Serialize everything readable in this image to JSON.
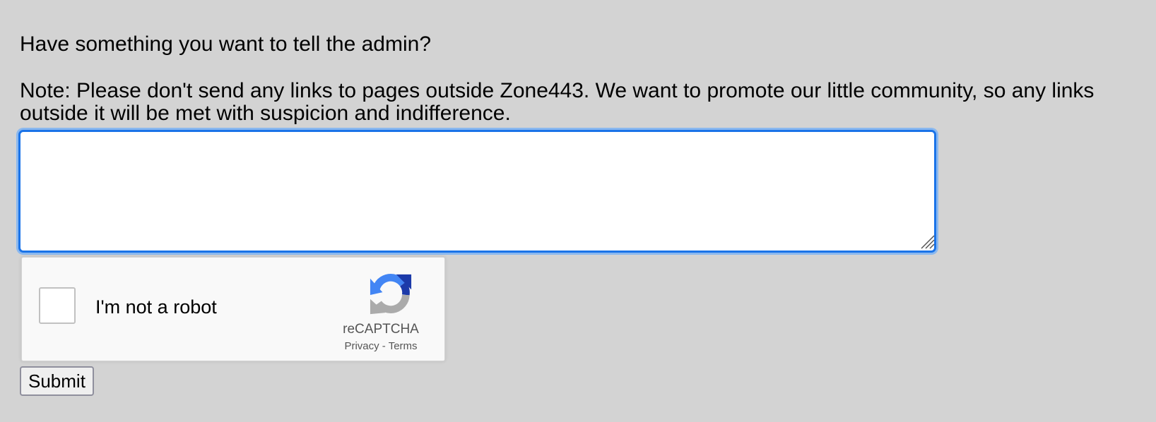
{
  "form": {
    "heading": "Have something you want to tell the admin?",
    "note": "Note: Please don't send any links to pages outside Zone443. We want to promote our little community, so any links outside it will be met with suspicion and indifference.",
    "message_value": "",
    "submit_label": "Submit"
  },
  "recaptcha": {
    "label": "I'm not a robot",
    "brand": "reCAPTCHA",
    "privacy_label": "Privacy",
    "separator": " - ",
    "terms_label": "Terms",
    "checked": false
  },
  "colors": {
    "page_background": "#d3d3d3",
    "focus_border": "#1a73e8",
    "recaptcha_blue": "#4285f4",
    "recaptcha_dark_blue": "#1c3aa9",
    "recaptcha_gray": "#ababab"
  }
}
